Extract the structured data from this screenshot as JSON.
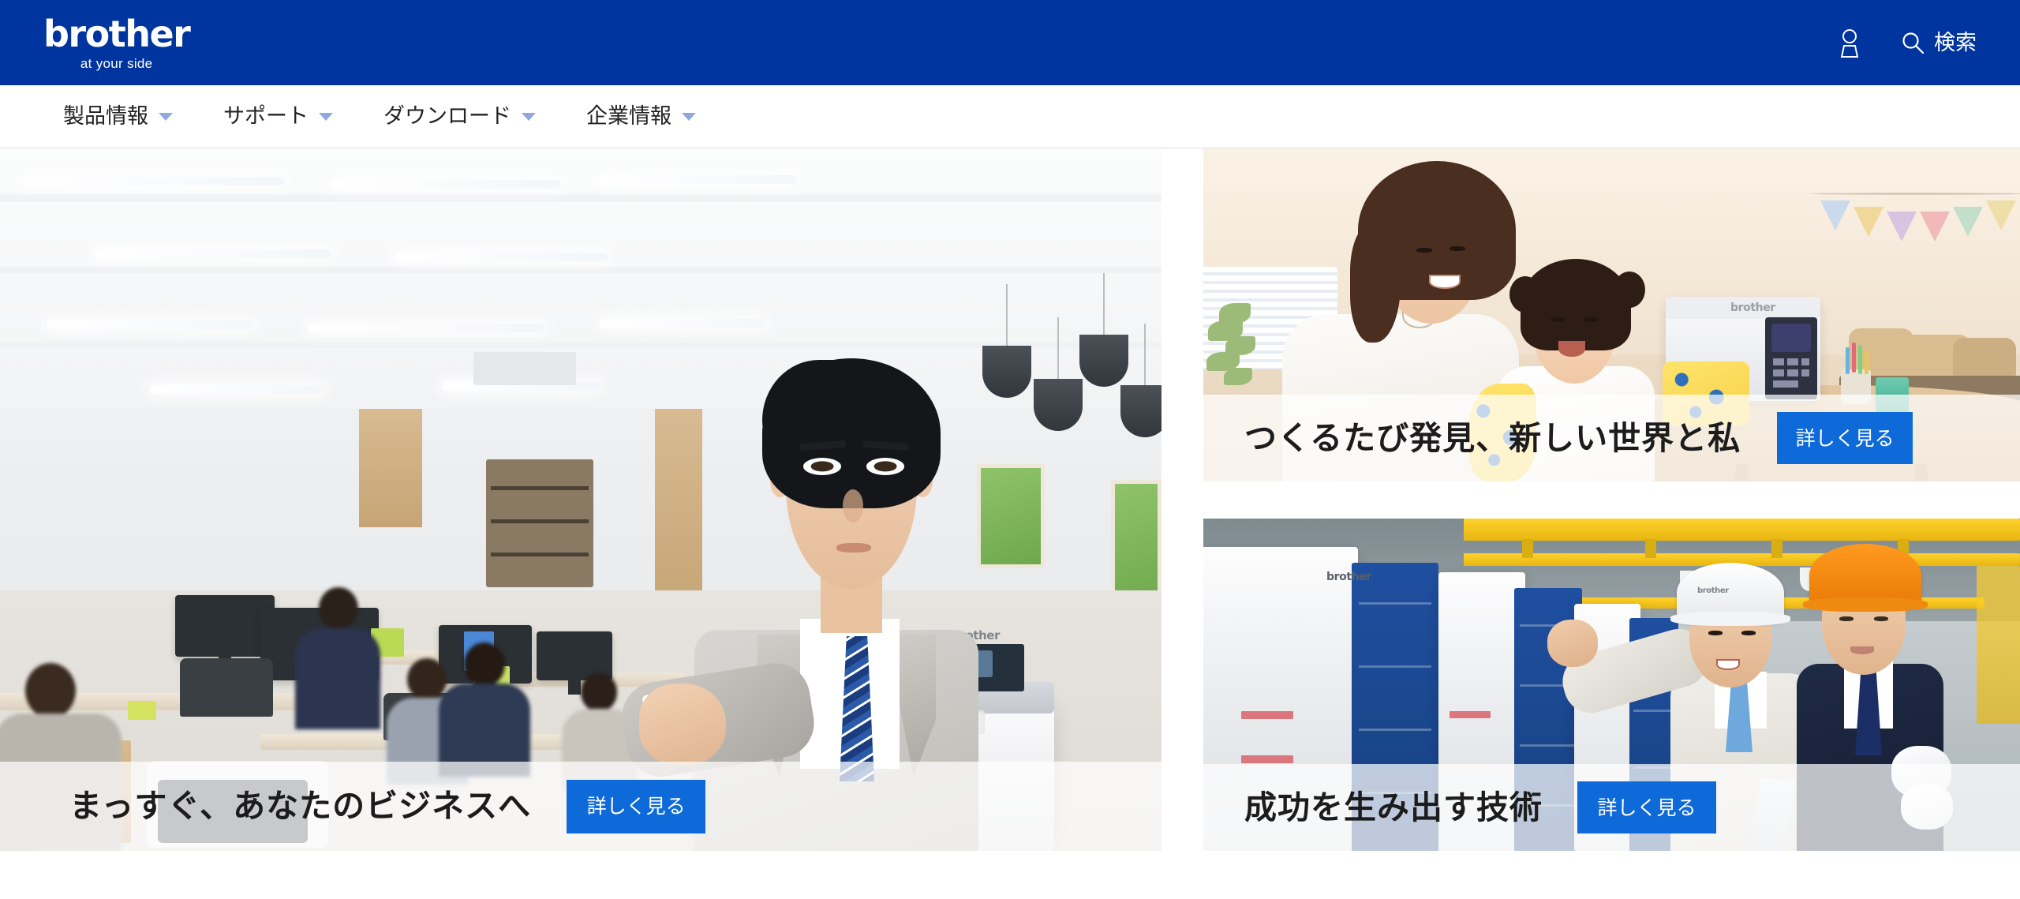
{
  "header": {
    "logo_word": "brother",
    "logo_tagline": "at your side",
    "account_icon": "person-icon",
    "search_icon": "search-icon",
    "search_label": "検索",
    "background_color": "#00349e"
  },
  "nav": {
    "items": [
      {
        "label": "製品情報",
        "caret": "chevron-down-icon"
      },
      {
        "label": "サポート",
        "caret": "chevron-down-icon"
      },
      {
        "label": "ダウンロード",
        "caret": "chevron-down-icon"
      },
      {
        "label": "企業情報",
        "caret": "chevron-down-icon"
      }
    ],
    "caret_color": "#8fa9dd"
  },
  "main": {
    "hero": {
      "name": "business-hero",
      "title": "まっすぐ、あなたのビジネスへ",
      "button_label": "詳しく見る",
      "scene": "office-printer-businessman"
    },
    "cards": [
      {
        "name": "sewing-card",
        "title": "つくるたび発見、新しい世界と私",
        "button_label": "詳しく見る",
        "scene": "mother-child-sewing-machine"
      },
      {
        "name": "factory-card",
        "title": "成功を生み出す技術",
        "button_label": "詳しく見る",
        "scene": "factory-machines-workers"
      }
    ]
  },
  "colors": {
    "brand_blue": "#00349e",
    "button_blue": "#0d6ad8",
    "nav_text": "#222222",
    "caption_text": "#1c1c1c"
  }
}
